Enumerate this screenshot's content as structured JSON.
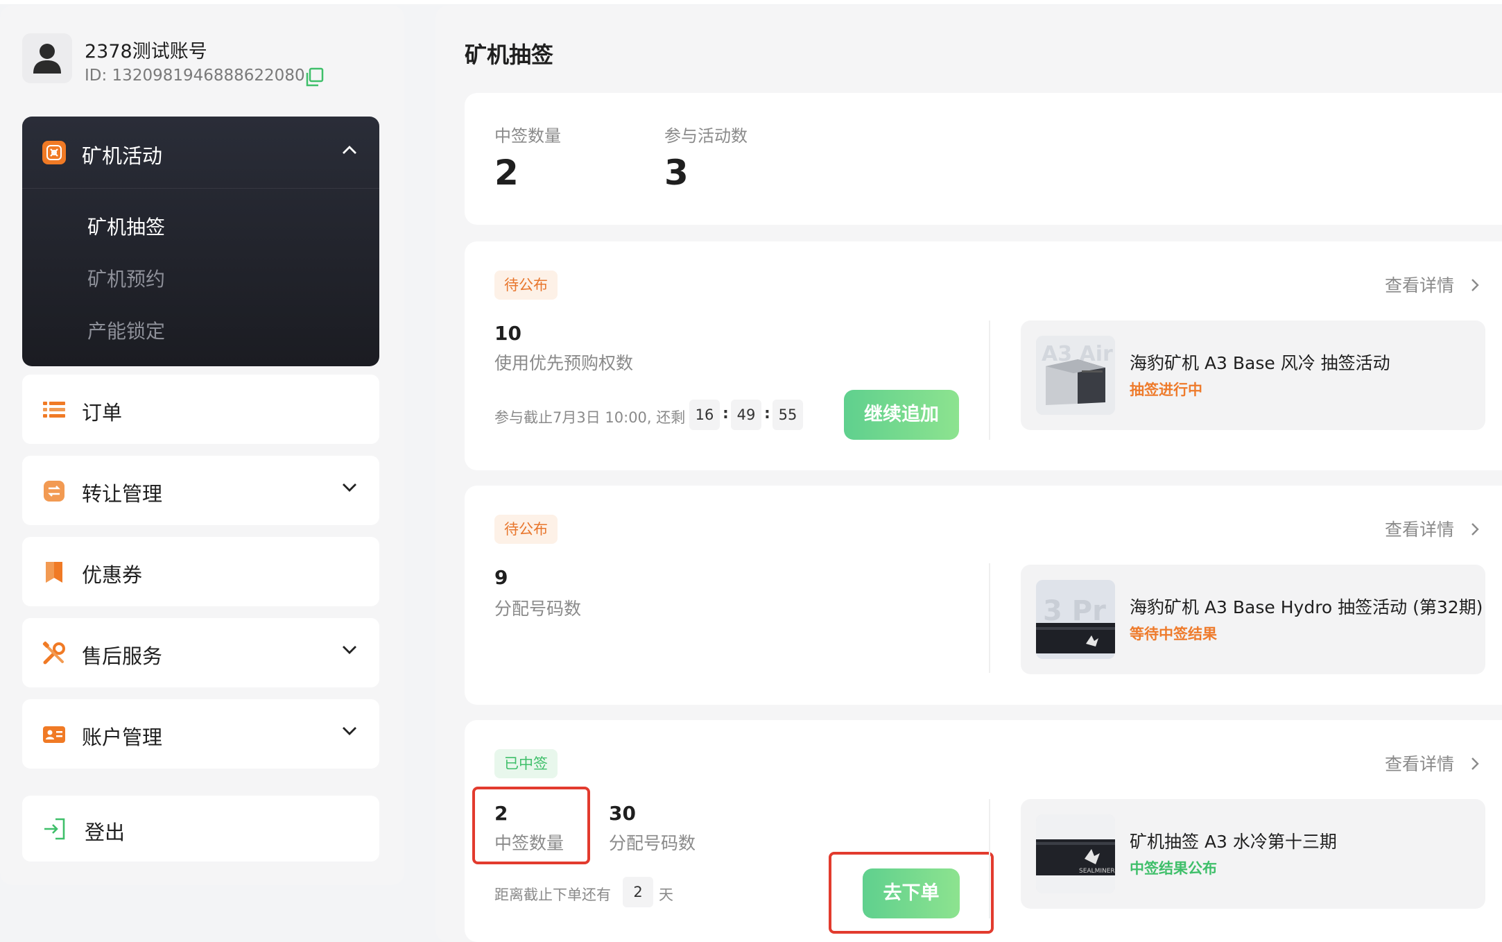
{
  "profile": {
    "name": "2378测试账号",
    "id_text": "ID: 1320981946888622080"
  },
  "sidebar": {
    "group": {
      "label": "矿机活动",
      "icon": "miner-activity-icon",
      "expanded": true,
      "sub_items": [
        {
          "label": "矿机抽签",
          "active": true
        },
        {
          "label": "矿机预约",
          "active": false
        },
        {
          "label": "产能锁定",
          "active": false
        }
      ]
    },
    "items": [
      {
        "label": "订单",
        "icon": "list-icon",
        "has_chevron": false
      },
      {
        "label": "转让管理",
        "icon": "transfer-icon",
        "has_chevron": true
      },
      {
        "label": "优惠券",
        "icon": "coupon-bookmark-icon",
        "has_chevron": false
      },
      {
        "label": "售后服务",
        "icon": "tools-icon",
        "has_chevron": true
      },
      {
        "label": "账户管理",
        "icon": "id-card-icon",
        "has_chevron": true
      }
    ],
    "logout": {
      "label": "登出",
      "icon": "logout-icon"
    }
  },
  "main": {
    "title": "矿机抽签",
    "summary": {
      "won_label": "中签数量",
      "won_value": "2",
      "joined_label": "参与活动数",
      "joined_value": "3"
    },
    "details_label": "查看详情",
    "cards": [
      {
        "badge": "待公布",
        "metric_value": "10",
        "metric_label": "使用优先预购权数",
        "deadline_text": "参与截止7月3日 10:00, 还剩",
        "countdown": [
          "16",
          "49",
          "55"
        ],
        "button": "继续追加",
        "product_title": "海豹矿机 A3 Base 风冷 抽签活动",
        "product_status": "抽签进行中"
      },
      {
        "badge": "待公布",
        "metric_value": "9",
        "metric_label": "分配号码数",
        "product_title": "海豹矿机 A3 Base Hydro 抽签活动 (第32期)",
        "product_status": "等待中签结果"
      },
      {
        "badge": "已中签",
        "won_value": "2",
        "won_label": "中签数量",
        "assigned_value": "30",
        "assigned_label": "分配号码数",
        "deadline_prefix": "距离截止下单还有",
        "deadline_days": "2",
        "deadline_unit": "天",
        "button": "去下单",
        "product_title": "矿机抽签 A3 水冷第十三期",
        "product_status": "中签结果公布"
      }
    ],
    "product_images": {
      "card1_text": "A3 Air",
      "card2_text": "3 Pr",
      "brand_text": "SEALMINER"
    }
  },
  "colors": {
    "accent_green": "#5fd08e",
    "accent_orange": "#ee7b2c",
    "highlight_red": "#e23b2e",
    "sidebar_dark": "#1f2028"
  }
}
